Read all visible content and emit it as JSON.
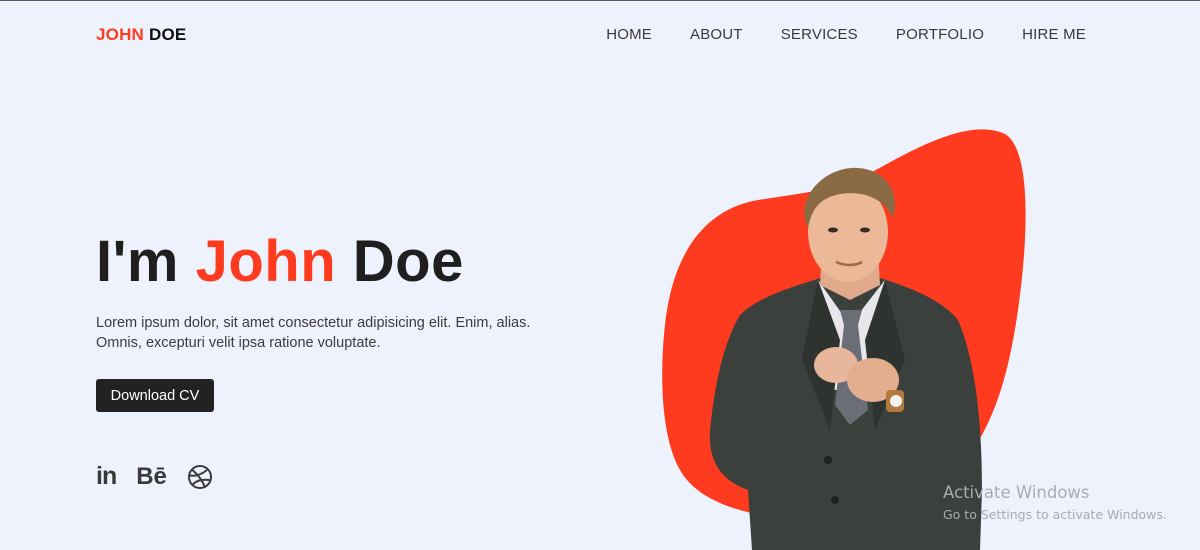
{
  "header": {
    "logo_first": "JOHN",
    "logo_last": "DOE",
    "nav": [
      {
        "label": "HOME"
      },
      {
        "label": "ABOUT"
      },
      {
        "label": "SERVICES"
      },
      {
        "label": "PORTFOLIO"
      },
      {
        "label": "HIRE ME"
      }
    ]
  },
  "hero": {
    "title_prefix": "I'm ",
    "title_accent": "John",
    "title_suffix": " Doe",
    "description_line1": "Lorem ipsum dolor, sit amet consectetur adipisicing elit. Enim, alias.",
    "description_line2": "Omnis, excepturi velit ipsa ratione voluptate.",
    "cta_label": "Download CV",
    "socials": [
      {
        "icon": "linkedin-icon",
        "glyph": "in"
      },
      {
        "icon": "behance-icon",
        "glyph": "Bē"
      },
      {
        "icon": "dribbble-icon"
      }
    ]
  },
  "watermark": {
    "title": "Activate Windows",
    "subtitle": "Go to Settings to activate Windows."
  },
  "colors": {
    "accent": "#ff3b1f",
    "background": "#eef2fc",
    "text_dark": "#1f1f1f",
    "button_bg": "#222222"
  }
}
